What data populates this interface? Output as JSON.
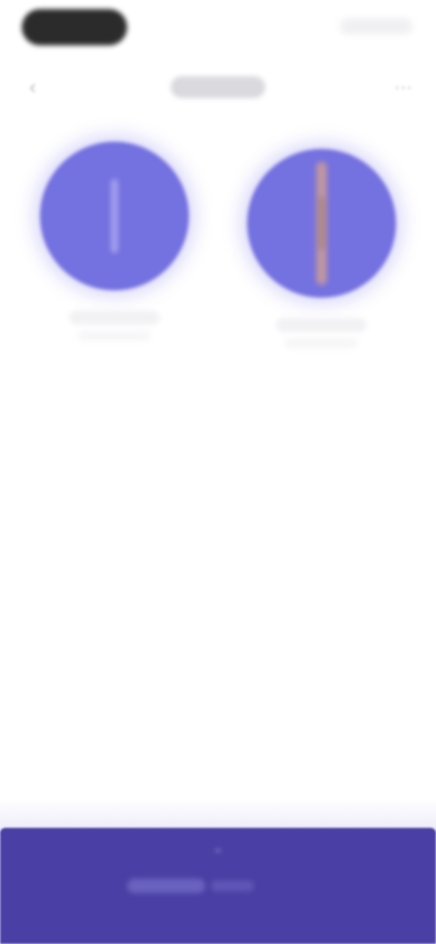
{
  "status_bar": {
    "time": "",
    "right_icons": ""
  },
  "top_bar": {
    "title": "",
    "back_icon": "chevron-left-icon",
    "more_icon": "more-icon"
  },
  "tiles": [
    {
      "label": "",
      "sublabel": "",
      "icon": "tile-icon",
      "color": "#7471e0"
    },
    {
      "label": "",
      "sublabel": "",
      "icon": "tile-icon",
      "color": "#7471e0"
    }
  ],
  "bottom_bar": {
    "icon": "bottom-icon",
    "label": "",
    "color": "#4a3fa4"
  }
}
